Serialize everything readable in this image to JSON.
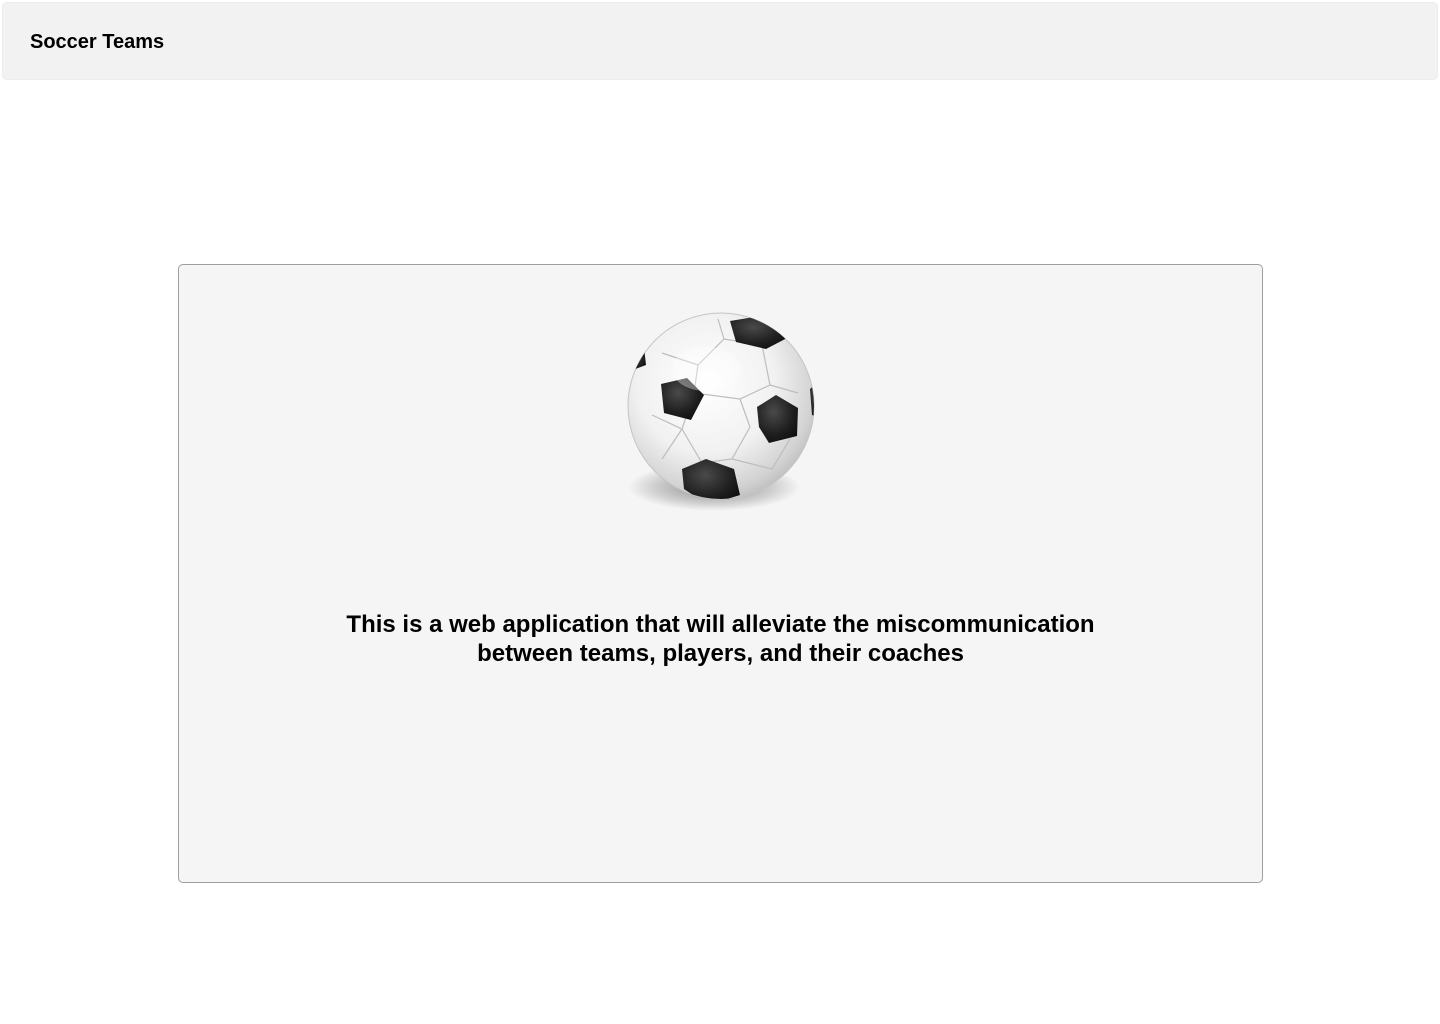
{
  "navbar": {
    "brand": "Soccer Teams"
  },
  "hero": {
    "image_icon": "soccer-ball-icon",
    "tagline_line1": "This is a web application that will alleviate the miscommunication",
    "tagline_line2": "between teams, players, and their coaches"
  },
  "colors": {
    "navbar_bg": "#f2f2f2",
    "card_bg": "#f5f5f5",
    "card_border": "#9e9e9e",
    "text": "#000000"
  }
}
